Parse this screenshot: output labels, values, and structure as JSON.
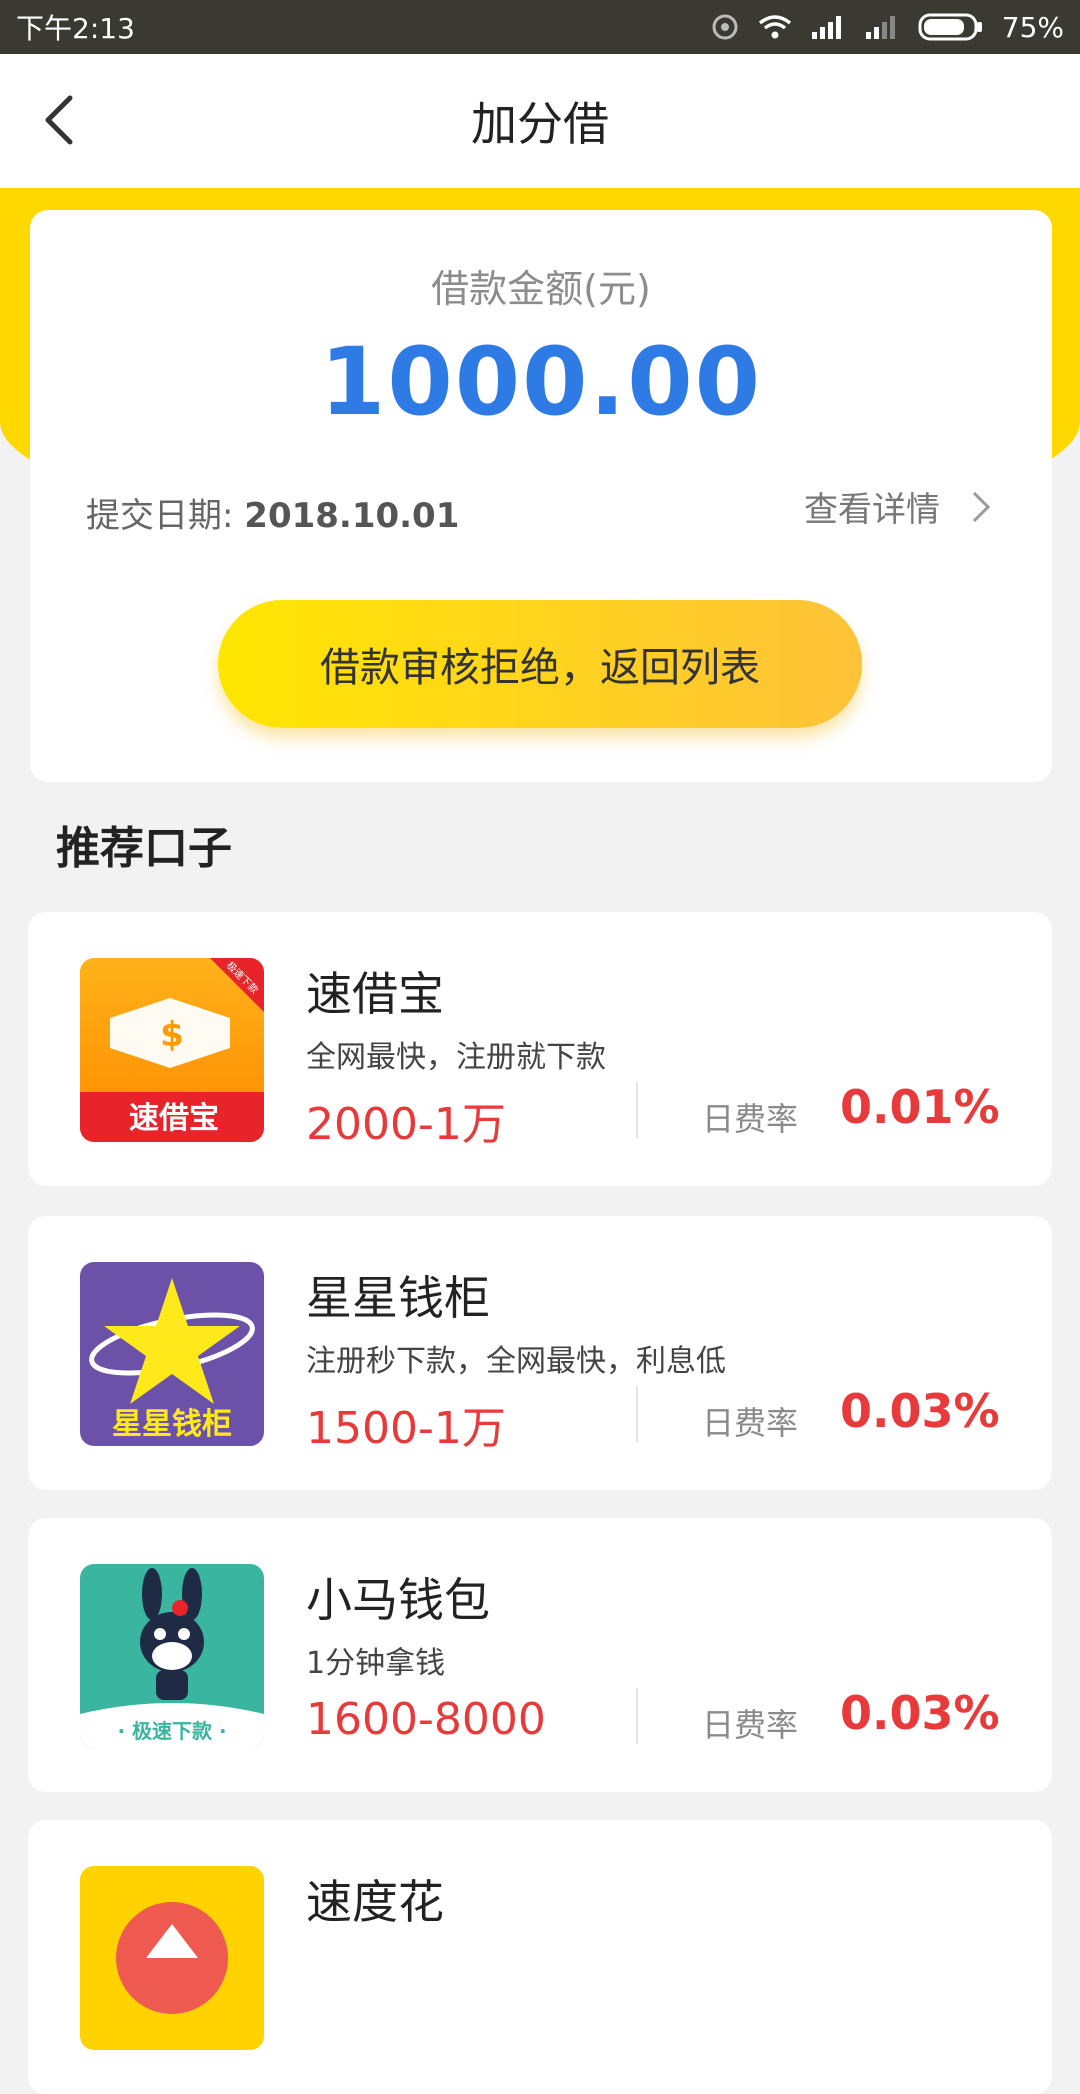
{
  "status_bar": {
    "time": "下午2:13",
    "battery": "75%"
  },
  "nav": {
    "title": "加分借"
  },
  "loan": {
    "amount_label": "借款金额(元)",
    "amount": "1000.00",
    "date_label": "提交日期:",
    "date": "2018.10.01",
    "detail_label": "查看详情",
    "button_label": "借款审核拒绝，返回列表"
  },
  "section": {
    "title": "推荐口子"
  },
  "products": [
    {
      "name": "速借宝",
      "desc": "全网最快，注册就下款",
      "range": "2000-1万",
      "rate_label": "日费率",
      "rate": "0.01%",
      "icon_text": "速借宝",
      "icon_badge": "极速下款"
    },
    {
      "name": "星星钱柜",
      "desc": "注册秒下款，全网最快，利息低",
      "range": "1500-1万",
      "rate_label": "日费率",
      "rate": "0.03%",
      "icon_text": "星星钱柜"
    },
    {
      "name": "小马钱包",
      "desc": "1分钟拿钱",
      "range": "1600-8000",
      "rate_label": "日费率",
      "rate": "0.03%",
      "icon_text": "· 极速下款 ·"
    },
    {
      "name": "速度花"
    }
  ],
  "colors": {
    "accent_yellow": "#ffd800",
    "amount_blue": "#2f7be5",
    "rate_red": "#e83a3a"
  }
}
